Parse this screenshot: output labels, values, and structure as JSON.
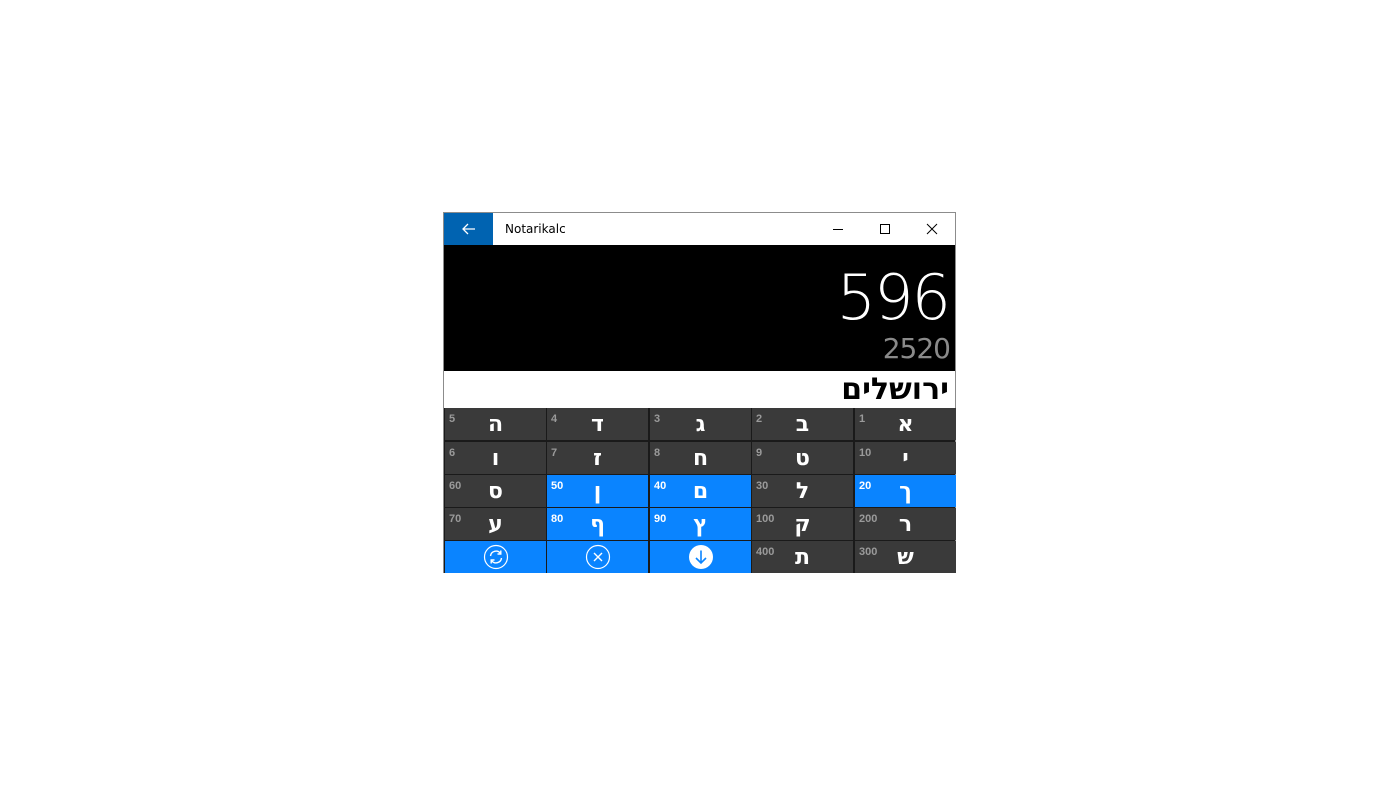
{
  "window": {
    "title": "Notarikalc"
  },
  "display": {
    "value": "596",
    "secondary_value": "2520",
    "word": "ירושלים"
  },
  "keypad": {
    "rows": [
      [
        {
          "num": "5",
          "letter": "ה",
          "highlighted": false
        },
        {
          "num": "4",
          "letter": "ד",
          "highlighted": false
        },
        {
          "num": "3",
          "letter": "ג",
          "highlighted": false
        },
        {
          "num": "2",
          "letter": "ב",
          "highlighted": false
        },
        {
          "num": "1",
          "letter": "א",
          "highlighted": false
        }
      ],
      [
        {
          "num": "6",
          "letter": "ו",
          "highlighted": false
        },
        {
          "num": "7",
          "letter": "ז",
          "highlighted": false
        },
        {
          "num": "8",
          "letter": "ח",
          "highlighted": false
        },
        {
          "num": "9",
          "letter": "ט",
          "highlighted": false
        },
        {
          "num": "10",
          "letter": "י",
          "highlighted": false
        }
      ],
      [
        {
          "num": "60",
          "letter": "ס",
          "highlighted": false
        },
        {
          "num": "50",
          "letter": "ן",
          "highlighted": true
        },
        {
          "num": "40",
          "letter": "ם",
          "highlighted": true
        },
        {
          "num": "30",
          "letter": "ל",
          "highlighted": false
        },
        {
          "num": "20",
          "letter": "ך",
          "highlighted": true
        }
      ],
      [
        {
          "num": "70",
          "letter": "ע",
          "highlighted": false
        },
        {
          "num": "80",
          "letter": "ף",
          "highlighted": true
        },
        {
          "num": "90",
          "letter": "ץ",
          "highlighted": true
        },
        {
          "num": "100",
          "letter": "ק",
          "highlighted": false
        },
        {
          "num": "200",
          "letter": "ר",
          "highlighted": false
        }
      ]
    ],
    "bottom_row": {
      "letters": [
        {
          "num": "400",
          "letter": "ת"
        },
        {
          "num": "300",
          "letter": "ש"
        }
      ],
      "actions": [
        {
          "name": "refresh-icon"
        },
        {
          "name": "clear-icon"
        },
        {
          "name": "save-down-icon"
        }
      ]
    }
  },
  "colors": {
    "accent": "#0a84ff",
    "titlebar_back": "#0063b1",
    "key_bg": "#3a3a3a",
    "display_bg": "#000000"
  }
}
